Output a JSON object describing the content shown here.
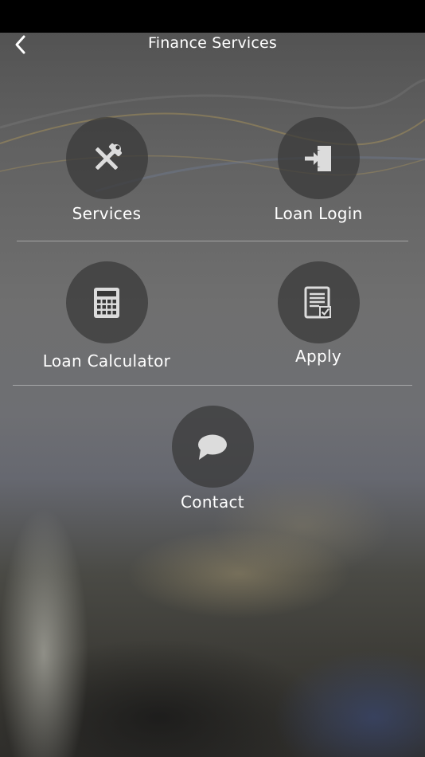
{
  "app": {
    "title": "Finance Services"
  },
  "navbar": {
    "back_icon": "chevron-left-icon"
  },
  "tiles": [
    {
      "label": "Services",
      "icon": "tools-icon"
    },
    {
      "label": "Loan Login",
      "icon": "login-icon"
    },
    {
      "label": "Loan Calculator",
      "icon": "calculator-icon"
    },
    {
      "label": "Apply",
      "icon": "application-form-icon"
    },
    {
      "label": "Contact",
      "icon": "chat-bubble-icon"
    }
  ],
  "colors": {
    "status_bar": "#000000",
    "circle_fill": "#373737",
    "icon_color": "#dcdcdc",
    "text": "#ffffff"
  }
}
